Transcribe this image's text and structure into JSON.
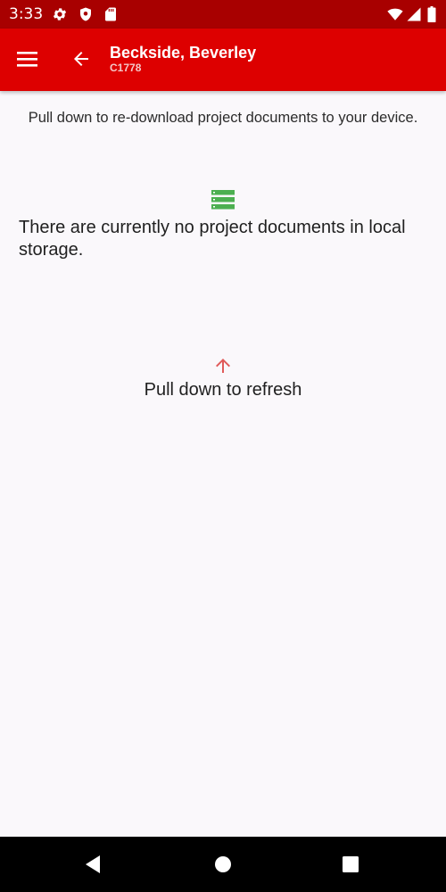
{
  "status_bar": {
    "time": "3:33",
    "icons": [
      "settings-icon",
      "shield-icon",
      "sd-card-icon",
      "wifi-icon",
      "signal-icon",
      "battery-icon"
    ],
    "background": "#a80000"
  },
  "app_bar": {
    "title": "Beckside, Beverley",
    "subtitle": "C1778",
    "background": "#dd0000",
    "menu_icon": "hamburger-menu-icon",
    "back_icon": "arrow-back-icon"
  },
  "content": {
    "hint": "Pull down to re-download project documents to your device.",
    "storage_icon": "storage-icon",
    "empty_message": "There are currently no project documents in local storage.",
    "refresh_icon": "arrow-up-icon",
    "refresh_label": "Pull down to refresh",
    "storage_icon_color": "#4caf50",
    "refresh_icon_color": "#e05a5a"
  },
  "nav_bar": {
    "buttons": [
      "back-triangle-icon",
      "home-circle-icon",
      "recents-square-icon"
    ]
  }
}
